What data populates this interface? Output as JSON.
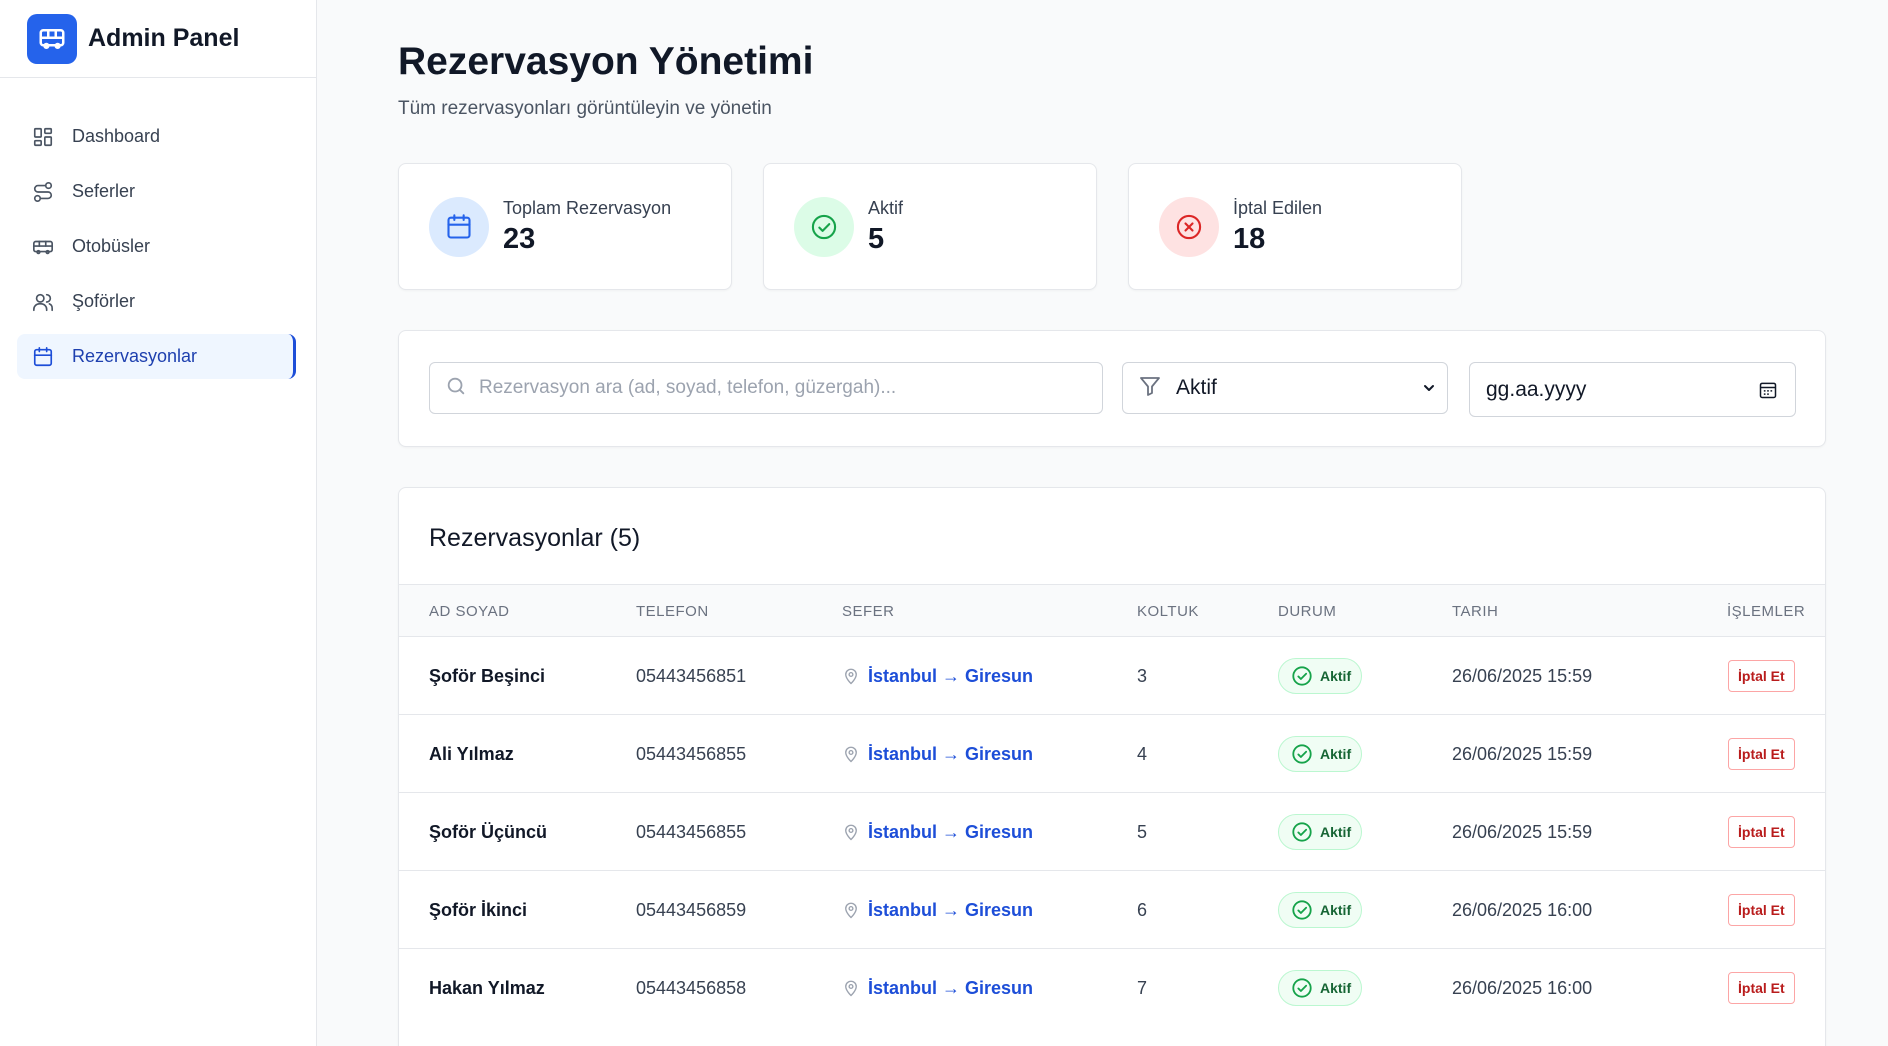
{
  "brand": {
    "title": "Admin Panel"
  },
  "sidebar": {
    "items": [
      {
        "label": "Dashboard",
        "icon": "dashboard-icon",
        "active": false
      },
      {
        "label": "Seferler",
        "icon": "route-icon",
        "active": false
      },
      {
        "label": "Otobüsler",
        "icon": "bus-icon",
        "active": false
      },
      {
        "label": "Şoförler",
        "icon": "users-icon",
        "active": false
      },
      {
        "label": "Rezervasyonlar",
        "icon": "calendar-icon",
        "active": true
      }
    ]
  },
  "header": {
    "title": "Rezervasyon Yönetimi",
    "subtitle": "Tüm rezervasyonları görüntüleyin ve yönetin"
  },
  "stats": [
    {
      "label": "Toplam Rezervasyon",
      "value": "23",
      "icon": "calendar-icon",
      "color": "#2563eb",
      "bg": "#dbeafe"
    },
    {
      "label": "Aktif",
      "value": "5",
      "icon": "check-circle-icon",
      "color": "#16a34a",
      "bg": "#dcfce7"
    },
    {
      "label": "İptal Edilen",
      "value": "18",
      "icon": "x-circle-icon",
      "color": "#dc2626",
      "bg": "#fee2e2"
    }
  ],
  "filters": {
    "search_placeholder": "Rezervasyon ara (ad, soyad, telefon, güzergah)...",
    "search_value": "",
    "status_selected": "Aktif",
    "date_value": "gg.aa.yyyy"
  },
  "table": {
    "title": "Rezervasyonlar (5)",
    "columns": [
      "Ad Soyad",
      "Telefon",
      "Sefer",
      "Koltuk",
      "Durum",
      "Tarih",
      "İşlemler"
    ],
    "rows": [
      {
        "name": "Şoför Beşinci",
        "phone": "05443456851",
        "route": "İstanbul → Giresun",
        "seat": "3",
        "status": "Aktif",
        "date": "26/06/2025 15:59",
        "action": "İptal Et"
      },
      {
        "name": "Ali Yılmaz",
        "phone": "05443456855",
        "route": "İstanbul → Giresun",
        "seat": "4",
        "status": "Aktif",
        "date": "26/06/2025 15:59",
        "action": "İptal Et"
      },
      {
        "name": "Şoför Üçüncü",
        "phone": "05443456855",
        "route": "İstanbul → Giresun",
        "seat": "5",
        "status": "Aktif",
        "date": "26/06/2025 15:59",
        "action": "İptal Et"
      },
      {
        "name": "Şoför İkinci",
        "phone": "05443456859",
        "route": "İstanbul → Giresun",
        "seat": "6",
        "status": "Aktif",
        "date": "26/06/2025 16:00",
        "action": "İptal Et"
      },
      {
        "name": "Hakan Yılmaz",
        "phone": "05443456858",
        "route": "İstanbul → Giresun",
        "seat": "7",
        "status": "Aktif",
        "date": "26/06/2025 16:00",
        "action": "İptal Et"
      }
    ]
  },
  "colors": {
    "accent": "#2563eb",
    "active_nav_bg": "#eff6ff",
    "link": "#1d4ed8",
    "success": "#16a34a",
    "danger": "#dc2626"
  }
}
